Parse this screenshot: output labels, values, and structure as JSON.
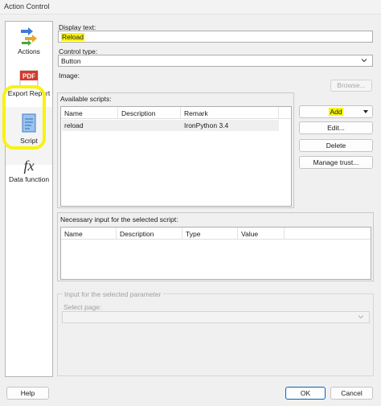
{
  "window": {
    "title": "Action Control"
  },
  "nav": [
    {
      "label": "Actions",
      "icon": "actions-icon"
    },
    {
      "label": "Export Report",
      "icon": "pdf-icon"
    },
    {
      "label": "Script",
      "icon": "script-icon",
      "selected": true
    },
    {
      "label": "Data function",
      "icon": "function-icon"
    }
  ],
  "display_text": {
    "label": "Display text:",
    "value": "Reload"
  },
  "control_type": {
    "label": "Control type:",
    "value": "Button"
  },
  "image": {
    "label": "Image:",
    "browse_label": "Browse..."
  },
  "available_scripts": {
    "legend": "Available scripts:",
    "columns": [
      "Name",
      "Description",
      "Remark"
    ],
    "rows": [
      {
        "name": "reload",
        "description": "",
        "remark": "IronPython 3.4"
      }
    ]
  },
  "buttons": {
    "add": "Add",
    "edit": "Edit...",
    "delete": "Delete",
    "manage_trust": "Manage trust...",
    "help": "Help",
    "ok": "OK",
    "cancel": "Cancel"
  },
  "necessary_input": {
    "legend": "Necessary input for the selected script:",
    "columns": [
      "Name",
      "Description",
      "Type",
      "Value"
    ]
  },
  "parameter_input": {
    "legend": "Input for the selected parameter",
    "select_page_label": "Select page:"
  },
  "colors": {
    "highlight": "#f7f313",
    "accent": "#0067c0"
  }
}
